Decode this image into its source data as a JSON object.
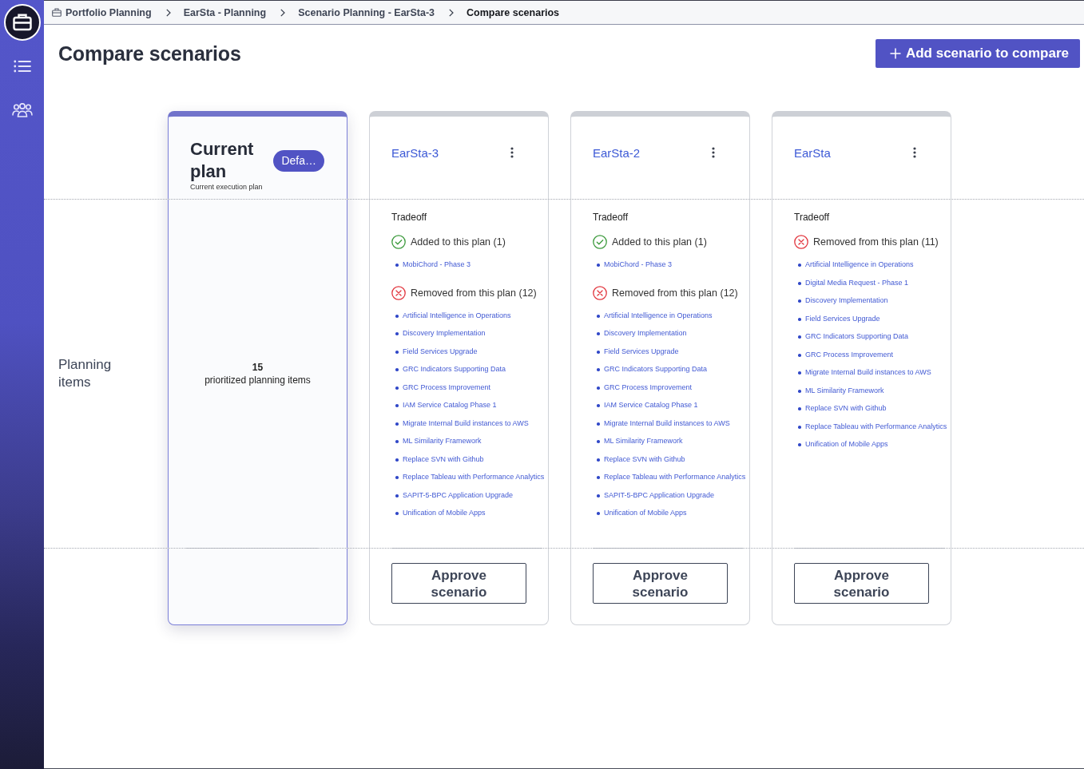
{
  "breadcrumb": [
    {
      "label": "Portfolio Planning",
      "current": false
    },
    {
      "label": "EarSta - Planning",
      "current": false
    },
    {
      "label": "Scenario Planning - EarSta-3",
      "current": false
    },
    {
      "label": "Compare scenarios",
      "current": true
    }
  ],
  "header": {
    "title": "Compare scenarios",
    "add_button": "Add scenario to compare"
  },
  "row_label": "Planning items",
  "current_plan": {
    "title": "Current plan",
    "badge": "Defa…",
    "subtitle": "Current execution plan",
    "count": "15",
    "count_label": "prioritized planning items"
  },
  "scenarios": [
    {
      "name": "EarSta-3",
      "tradeoff_label": "Tradeoff",
      "groups": [
        {
          "kind": "added",
          "label": "Added to this plan (1)",
          "items": [
            "MobiChord - Phase 3"
          ]
        },
        {
          "kind": "removed",
          "label": "Removed from this plan (12)",
          "items": [
            "Artificial Intelligence in Operations",
            "Discovery Implementation",
            "Field Services Upgrade",
            "GRC Indicators Supporting Data",
            "GRC Process Improvement",
            "IAM Service Catalog Phase 1",
            "Migrate Internal Build instances to AWS",
            "ML Similarity Framework",
            "Replace SVN with Github",
            "Replace Tableau with Performance Analytics",
            "SAPIT-5-BPC Application Upgrade",
            "Unification of Mobile Apps"
          ]
        }
      ],
      "approve_button": "Approve scenario"
    },
    {
      "name": "EarSta-2",
      "tradeoff_label": "Tradeoff",
      "groups": [
        {
          "kind": "added",
          "label": "Added to this plan (1)",
          "items": [
            "MobiChord - Phase 3"
          ]
        },
        {
          "kind": "removed",
          "label": "Removed from this plan (12)",
          "items": [
            "Artificial Intelligence in Operations",
            "Discovery Implementation",
            "Field Services Upgrade",
            "GRC Indicators Supporting Data",
            "GRC Process Improvement",
            "IAM Service Catalog Phase 1",
            "Migrate Internal Build instances to AWS",
            "ML Similarity Framework",
            "Replace SVN with Github",
            "Replace Tableau with Performance Analytics",
            "SAPIT-5-BPC Application Upgrade",
            "Unification of Mobile Apps"
          ]
        }
      ],
      "approve_button": "Approve scenario"
    },
    {
      "name": "EarSta",
      "tradeoff_label": "Tradeoff",
      "groups": [
        {
          "kind": "removed",
          "label": "Removed from this plan (11)",
          "items": [
            "Artificial Intelligence in Operations",
            "Digital Media Request - Phase 1",
            "Discovery Implementation",
            "Field Services Upgrade",
            "GRC Indicators Supporting Data",
            "GRC Process Improvement",
            "Migrate Internal Build instances to AWS",
            "ML Similarity Framework",
            "Replace SVN with Github",
            "Replace Tableau with Performance Analytics",
            "Unification of Mobile Apps"
          ]
        }
      ],
      "approve_button": "Approve scenario"
    }
  ]
}
